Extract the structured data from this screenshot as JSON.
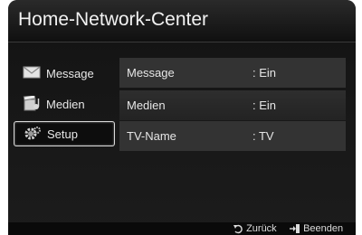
{
  "header": {
    "title": "Home-Network-Center"
  },
  "sidebar": {
    "items": [
      {
        "label": "Message",
        "icon": "envelope-icon"
      },
      {
        "label": "Medien",
        "icon": "media-icon"
      },
      {
        "label": "Setup",
        "icon": "gear-icon"
      }
    ]
  },
  "settings": {
    "rows": [
      {
        "name": "Message",
        "value": ": Ein"
      },
      {
        "name": "Medien",
        "value": ": Ein"
      },
      {
        "name": "TV-Name",
        "value": ": TV"
      }
    ]
  },
  "footer": {
    "back_label": "Zurück",
    "exit_label": "Beenden"
  },
  "colors": {
    "panel_bg": "#151515",
    "row_bg": "#333333",
    "selected_border": "#d8d8d8"
  }
}
